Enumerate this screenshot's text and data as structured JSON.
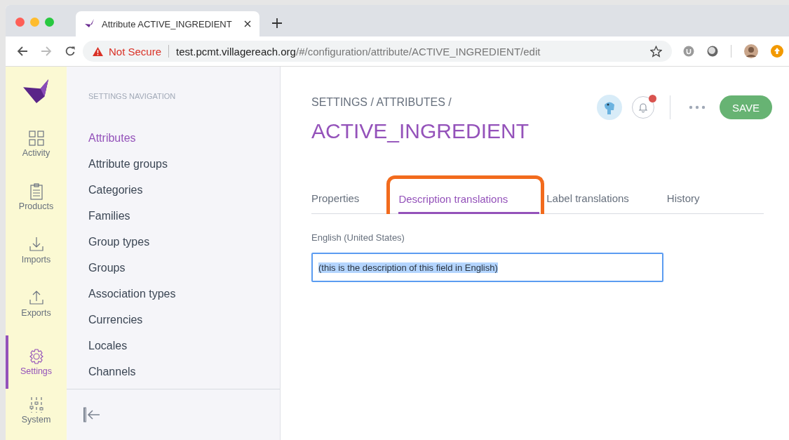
{
  "browser": {
    "tab": {
      "title": "Attribute ACTIVE_INGREDIENT"
    },
    "address": {
      "security": "Not Secure",
      "host": "test.pcmt.villagereach.org",
      "path": "/#/configuration/attribute/ACTIVE_INGREDIENT/edit"
    }
  },
  "rail": {
    "items": [
      {
        "kind": "activity",
        "label": "Activity",
        "selected": false
      },
      {
        "kind": "products",
        "label": "Products",
        "selected": false
      },
      {
        "kind": "imports",
        "label": "Imports",
        "selected": false
      },
      {
        "kind": "exports",
        "label": "Exports",
        "selected": false
      },
      {
        "kind": "settings",
        "label": "Settings",
        "selected": true
      },
      {
        "kind": "system",
        "label": "System",
        "selected": false
      }
    ]
  },
  "sidebar": {
    "heading": "SETTINGS NAVIGATION",
    "items": [
      {
        "label": "Attributes",
        "selected": true
      },
      {
        "label": "Attribute groups",
        "selected": false
      },
      {
        "label": "Categories",
        "selected": false
      },
      {
        "label": "Families",
        "selected": false
      },
      {
        "label": "Group types",
        "selected": false
      },
      {
        "label": "Groups",
        "selected": false
      },
      {
        "label": "Association types",
        "selected": false
      },
      {
        "label": "Currencies",
        "selected": false
      },
      {
        "label": "Locales",
        "selected": false
      },
      {
        "label": "Channels",
        "selected": false
      }
    ]
  },
  "header": {
    "breadcrumb": "SETTINGS / ATTRIBUTES /",
    "title": "ACTIVE_INGREDIENT",
    "notification": true,
    "save": "SAVE"
  },
  "tabs": [
    {
      "label": "Properties",
      "selected": false
    },
    {
      "label": "Description translations",
      "selected": true
    },
    {
      "label": "Label translations",
      "selected": false
    },
    {
      "label": "History",
      "selected": false
    }
  ],
  "field": {
    "label": "English (United States)",
    "value": "(this is the description of this field in English)",
    "text_selected": true
  }
}
